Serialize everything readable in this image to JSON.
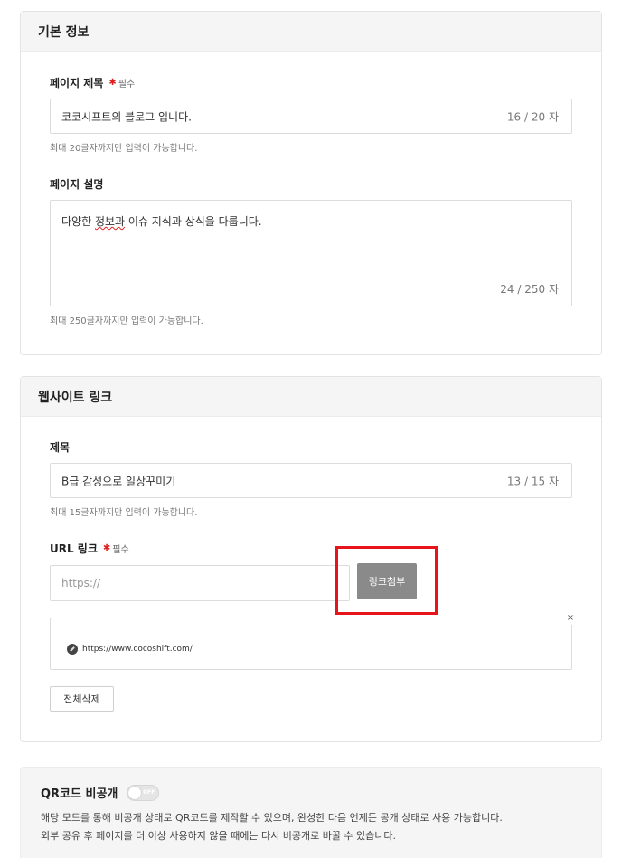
{
  "basic_info": {
    "section_title": "기본 정보",
    "page_title": {
      "label": "페이지 제목",
      "required": "필수",
      "value": "코코시프트의 블로그 입니다.",
      "count": "16 / 20 자",
      "helper": "최대 20글자까지만 입력이 가능합니다."
    },
    "page_desc": {
      "label": "페이지 설명",
      "value_before": "다양한 ",
      "value_marked": "정보과",
      "value_after": " 이슈 지식과 상식을 다룹니다.",
      "count": "24 / 250 자",
      "helper": "최대 250글자까지만 입력이 가능합니다."
    }
  },
  "website_link": {
    "section_title": "웹사이트 링크",
    "title_field": {
      "label": "제목",
      "value": "B급 감성으로 일상꾸미기",
      "count": "13 / 15 자",
      "helper": "최대 15글자까지만 입력이 가능합니다."
    },
    "url_field": {
      "label": "URL 링크",
      "required": "필수",
      "placeholder": "https://",
      "attach_button": "링크첨부"
    },
    "attached_link": "https://www.cocoshift.com/",
    "close_symbol": "×",
    "delete_all_button": "전체삭제"
  },
  "qr": {
    "title": "QR코드 비공개",
    "toggle_state": "OFF",
    "desc_line1": "해당 모드를 통해 비공개 상태로 QR코드를 제작할 수 있으며, 완성한 다음 언제든 공개 상태로 사용 가능합니다.",
    "desc_line2": "외부 공유 후 페이지를 더 이상 사용하지 않을 때에는 다시 비공개로 바꿀 수 있습니다."
  },
  "colors": {
    "highlight": "#e8141c",
    "required_mark": "#e02020",
    "attach_button_bg": "#8a8a8a"
  }
}
